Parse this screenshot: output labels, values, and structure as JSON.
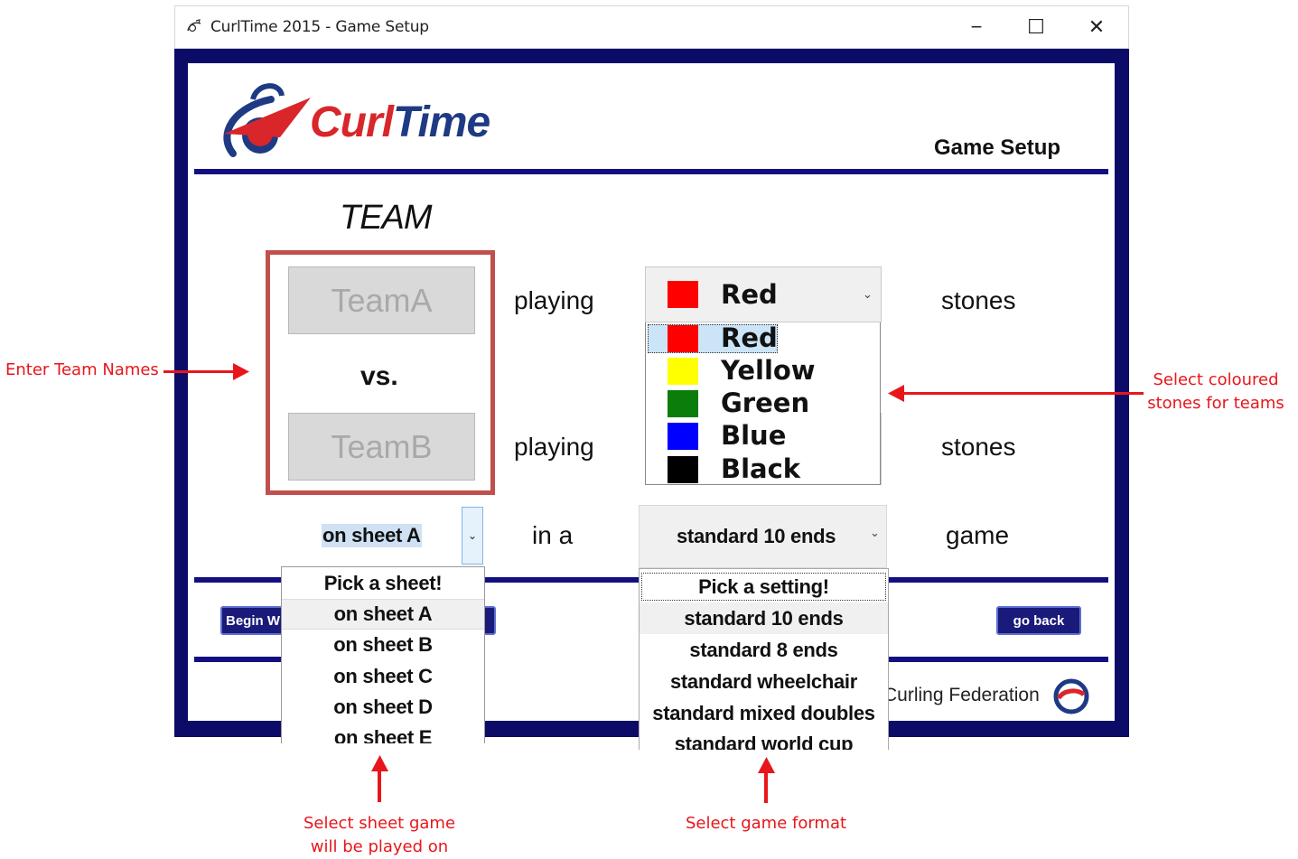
{
  "window": {
    "title": "CurlTime 2015 - Game Setup",
    "controls": {
      "minimize": "−",
      "maximize": "☐",
      "close": "✕"
    }
  },
  "header": {
    "logo_curl": "Curl",
    "logo_time": "Time",
    "page_heading": "Game Setup"
  },
  "team_section": {
    "heading": "TEAM",
    "team_a_placeholder": "TeamA",
    "vs": "vs.",
    "team_b_placeholder": "TeamB",
    "playing_label_1": "playing",
    "playing_label_2": "playing",
    "stones_label_1": "stones",
    "stones_label_2": "stones"
  },
  "stone_combo": {
    "selected": "Red",
    "selected_color": "#ff0000",
    "options": [
      {
        "label": "Red",
        "color": "#ff0000"
      },
      {
        "label": "Yellow",
        "color": "#ffff00"
      },
      {
        "label": "Green",
        "color": "#0a7d0a"
      },
      {
        "label": "Blue",
        "color": "#0000ff"
      },
      {
        "label": "Black",
        "color": "#000000"
      }
    ]
  },
  "sheet_combo": {
    "selected": "on sheet A",
    "options": [
      "Pick a sheet!",
      "on sheet A",
      "on sheet B",
      "on sheet C",
      "on sheet D",
      "on sheet E"
    ]
  },
  "in_a_label": "in a",
  "format_combo": {
    "selected": "standard 10 ends",
    "options": [
      "Pick a setting!",
      "standard 10 ends",
      "standard 8 ends",
      "standard wheelchair",
      "standard mixed doubles",
      "standard world cup"
    ]
  },
  "game_label": "game",
  "buttons": {
    "begin": "Begin W",
    "go_back": "go back"
  },
  "footer": {
    "federation": "Curling Federation"
  },
  "annotations": {
    "team_names": "Enter Team Names",
    "stones_line1": "Select coloured",
    "stones_line2": "stones for teams",
    "sheet_line1": "Select sheet game",
    "sheet_line2": "will be played on",
    "format": "Select game format"
  },
  "colors": {
    "frame_navy": "#0d0b68",
    "annotation_red": "#e8161b",
    "team_box_border": "#c0504d"
  }
}
